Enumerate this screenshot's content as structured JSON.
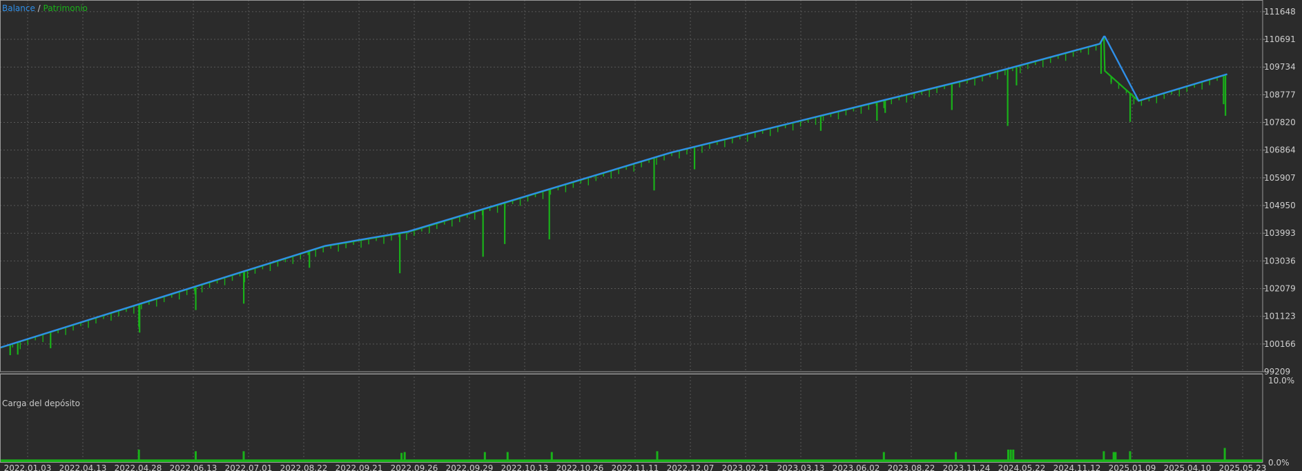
{
  "legend": {
    "balance_label": "Balance",
    "separator": " / ",
    "equity_label": "Patrimonio"
  },
  "deposit_panel_label": "Carga del depósito",
  "colors": {
    "background": "#2b2b2b",
    "grid": "#5a5a5a",
    "balance": "#2f8fe8",
    "equity": "#19b219",
    "load": "#19b219",
    "text": "#d0d0d0",
    "frame": "#9a9a9a"
  },
  "chart_data": [
    {
      "type": "line",
      "yticks": [
        99209,
        100166,
        101123,
        102079,
        103036,
        103993,
        104950,
        105907,
        106864,
        107820,
        108777,
        109734,
        110691,
        111648
      ],
      "ylim": [
        99209,
        112050
      ],
      "xtick_labels": [
        "2022.01.03",
        "2022.04.13",
        "2022.04.28",
        "2022.06.13",
        "2022.07.01",
        "2022.08.22",
        "2022.09.21",
        "2022.09.26",
        "2022.09.29",
        "2022.10.13",
        "2022.10.26",
        "2022.11.11",
        "2022.12.07",
        "2023.02.21",
        "2023.03.13",
        "2023.06.02",
        "2023.08.22",
        "2023.11.24",
        "2024.05.22",
        "2024.11.12",
        "2025.01.09",
        "2025.04.10",
        "2025.05.23"
      ],
      "xlim": [
        0,
        1
      ],
      "series": [
        {
          "name": "Balance",
          "color": "#2f8fe8",
          "x": [
            0,
            0.2577,
            0.3232,
            0.5314,
            0.7633,
            0.8711,
            0.8743,
            0.875,
            0.9018,
            0.9719
          ],
          "y": [
            100040,
            103560,
            104050,
            106780,
            109270,
            110540,
            110790,
            110790,
            108570,
            109490
          ]
        },
        {
          "name": "Patrimonio",
          "color": "#19b219",
          "x": [
            0,
            0.2577,
            0.3232,
            0.5314,
            0.7633,
            0.8711,
            0.8743,
            0.875,
            0.9018,
            0.9719
          ],
          "y": [
            100030,
            103545,
            104030,
            106770,
            109255,
            110530,
            110760,
            109600,
            108560,
            109480
          ],
          "drawdowns": [
            {
              "x": 0.008,
              "y": 99780
            },
            {
              "x": 0.014,
              "y": 99800
            },
            {
              "x": 0.04,
              "y": 100020
            },
            {
              "x": 0.11,
              "y": 100750
            },
            {
              "x": 0.1105,
              "y": 100560
            },
            {
              "x": 0.155,
              "y": 101340
            },
            {
              "x": 0.1545,
              "y": 101880
            },
            {
              "x": 0.193,
              "y": 101560
            },
            {
              "x": 0.1935,
              "y": 102300
            },
            {
              "x": 0.245,
              "y": 102800
            },
            {
              "x": 0.3166,
              "y": 102610
            },
            {
              "x": 0.3825,
              "y": 103180
            },
            {
              "x": 0.3997,
              "y": 103620
            },
            {
              "x": 0.435,
              "y": 103780
            },
            {
              "x": 0.518,
              "y": 105470
            },
            {
              "x": 0.55,
              "y": 106200
            },
            {
              "x": 0.65,
              "y": 107530
            },
            {
              "x": 0.6945,
              "y": 107880
            },
            {
              "x": 0.701,
              "y": 108150
            },
            {
              "x": 0.7538,
              "y": 108250
            },
            {
              "x": 0.798,
              "y": 107700
            },
            {
              "x": 0.805,
              "y": 109100
            },
            {
              "x": 0.872,
              "y": 109500
            },
            {
              "x": 0.88,
              "y": 109200
            },
            {
              "x": 0.895,
              "y": 107840
            },
            {
              "x": 0.93,
              "y": 108900
            },
            {
              "x": 0.969,
              "y": 108450
            },
            {
              "x": 0.9705,
              "y": 108050
            }
          ]
        }
      ]
    },
    {
      "type": "bar",
      "panel": "Carga del depósito",
      "yticks": [
        "0.0%",
        "10.0%"
      ],
      "ylim": [
        0,
        10
      ],
      "baseline_value": 0.4,
      "spikes": [
        {
          "x": 0.11,
          "value": 1.6
        },
        {
          "x": 0.155,
          "value": 1.4
        },
        {
          "x": 0.193,
          "value": 1.4
        },
        {
          "x": 0.318,
          "value": 1.2
        },
        {
          "x": 0.3205,
          "value": 1.3
        },
        {
          "x": 0.384,
          "value": 1.3
        },
        {
          "x": 0.402,
          "value": 1.3
        },
        {
          "x": 0.437,
          "value": 1.3
        },
        {
          "x": 0.5205,
          "value": 1.4
        },
        {
          "x": 0.7,
          "value": 1.3
        },
        {
          "x": 0.757,
          "value": 1.3
        },
        {
          "x": 0.7985,
          "value": 1.6
        },
        {
          "x": 0.8005,
          "value": 1.6
        },
        {
          "x": 0.8025,
          "value": 1.6
        },
        {
          "x": 0.8742,
          "value": 1.4
        },
        {
          "x": 0.882,
          "value": 1.3
        },
        {
          "x": 0.8835,
          "value": 1.3
        },
        {
          "x": 0.895,
          "value": 1.4
        },
        {
          "x": 0.97,
          "value": 1.8
        }
      ]
    }
  ]
}
